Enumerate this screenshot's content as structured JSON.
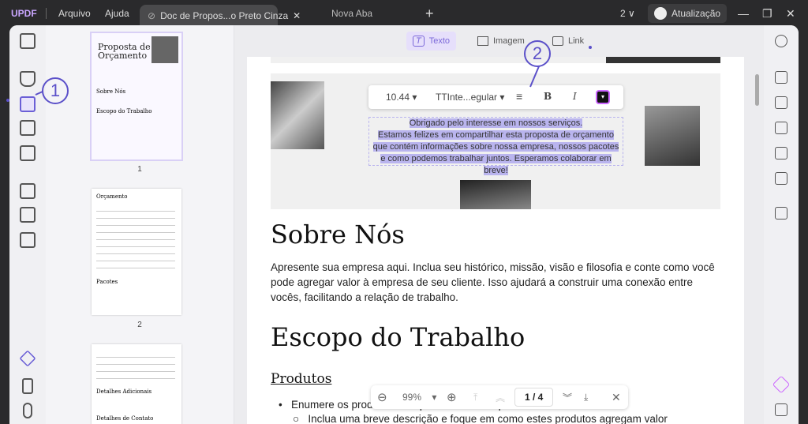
{
  "titlebar": {
    "logo": "UPDF",
    "menu_file": "Arquivo",
    "menu_help": "Ajuda",
    "tab_active": "Doc de Propos...o Preto Cinza",
    "tab_new": "Nova Aba",
    "add_tab": "+",
    "window_count": "2 ∨",
    "update": "Atualização"
  },
  "toolbar": {
    "text": "Texto",
    "image": "Imagem",
    "link": "Link"
  },
  "format": {
    "font_size": "10.44",
    "font_name": "TTInte...egular",
    "bold": "B",
    "italic": "I"
  },
  "thumbnails": [
    {
      "num": "1",
      "title": "Proposta de Orçamento",
      "h1": "Sobre Nós",
      "h2": "Escopo do Trabalho"
    },
    {
      "num": "2",
      "title": "Orçamento",
      "h2": "Pacotes"
    },
    {
      "num": "3",
      "h1": "Detalhes Adicionais",
      "h2": "Detalhes de Contato"
    }
  ],
  "page": {
    "intro": [
      "Obrigado pelo interesse em nossos serviços.",
      "Estamos felizes em compartilhar esta proposta de orçamento",
      "que contém informações sobre nossa empresa, nossos pacotes",
      "e como podemos trabalhar juntos. Esperamos colaborar em breve!"
    ],
    "about_title": "Sobre Nós",
    "about_text": "Apresente sua empresa aqui. Inclua seu histórico, missão, visão e filosofia e conte como você pode agregar valor à empresa de seu cliente. Isso ajudará a construir uma conexão entre vocês, facilitando a relação de trabalho.",
    "scope_title": "Escopo do Trabalho",
    "products_title": "Produtos",
    "bullet1": "Enumere os produtos nos quais seu cliente pode estar interessado",
    "bullet2": "Inclua uma breve descrição e foque em como estes produtos agregam valor"
  },
  "pager": {
    "zoom": "99%",
    "page": "1 / 4"
  },
  "annotations": {
    "one": "1",
    "two": "2"
  },
  "colors": {
    "accent": "#5b50c9",
    "selection": "#b9b4ee"
  }
}
